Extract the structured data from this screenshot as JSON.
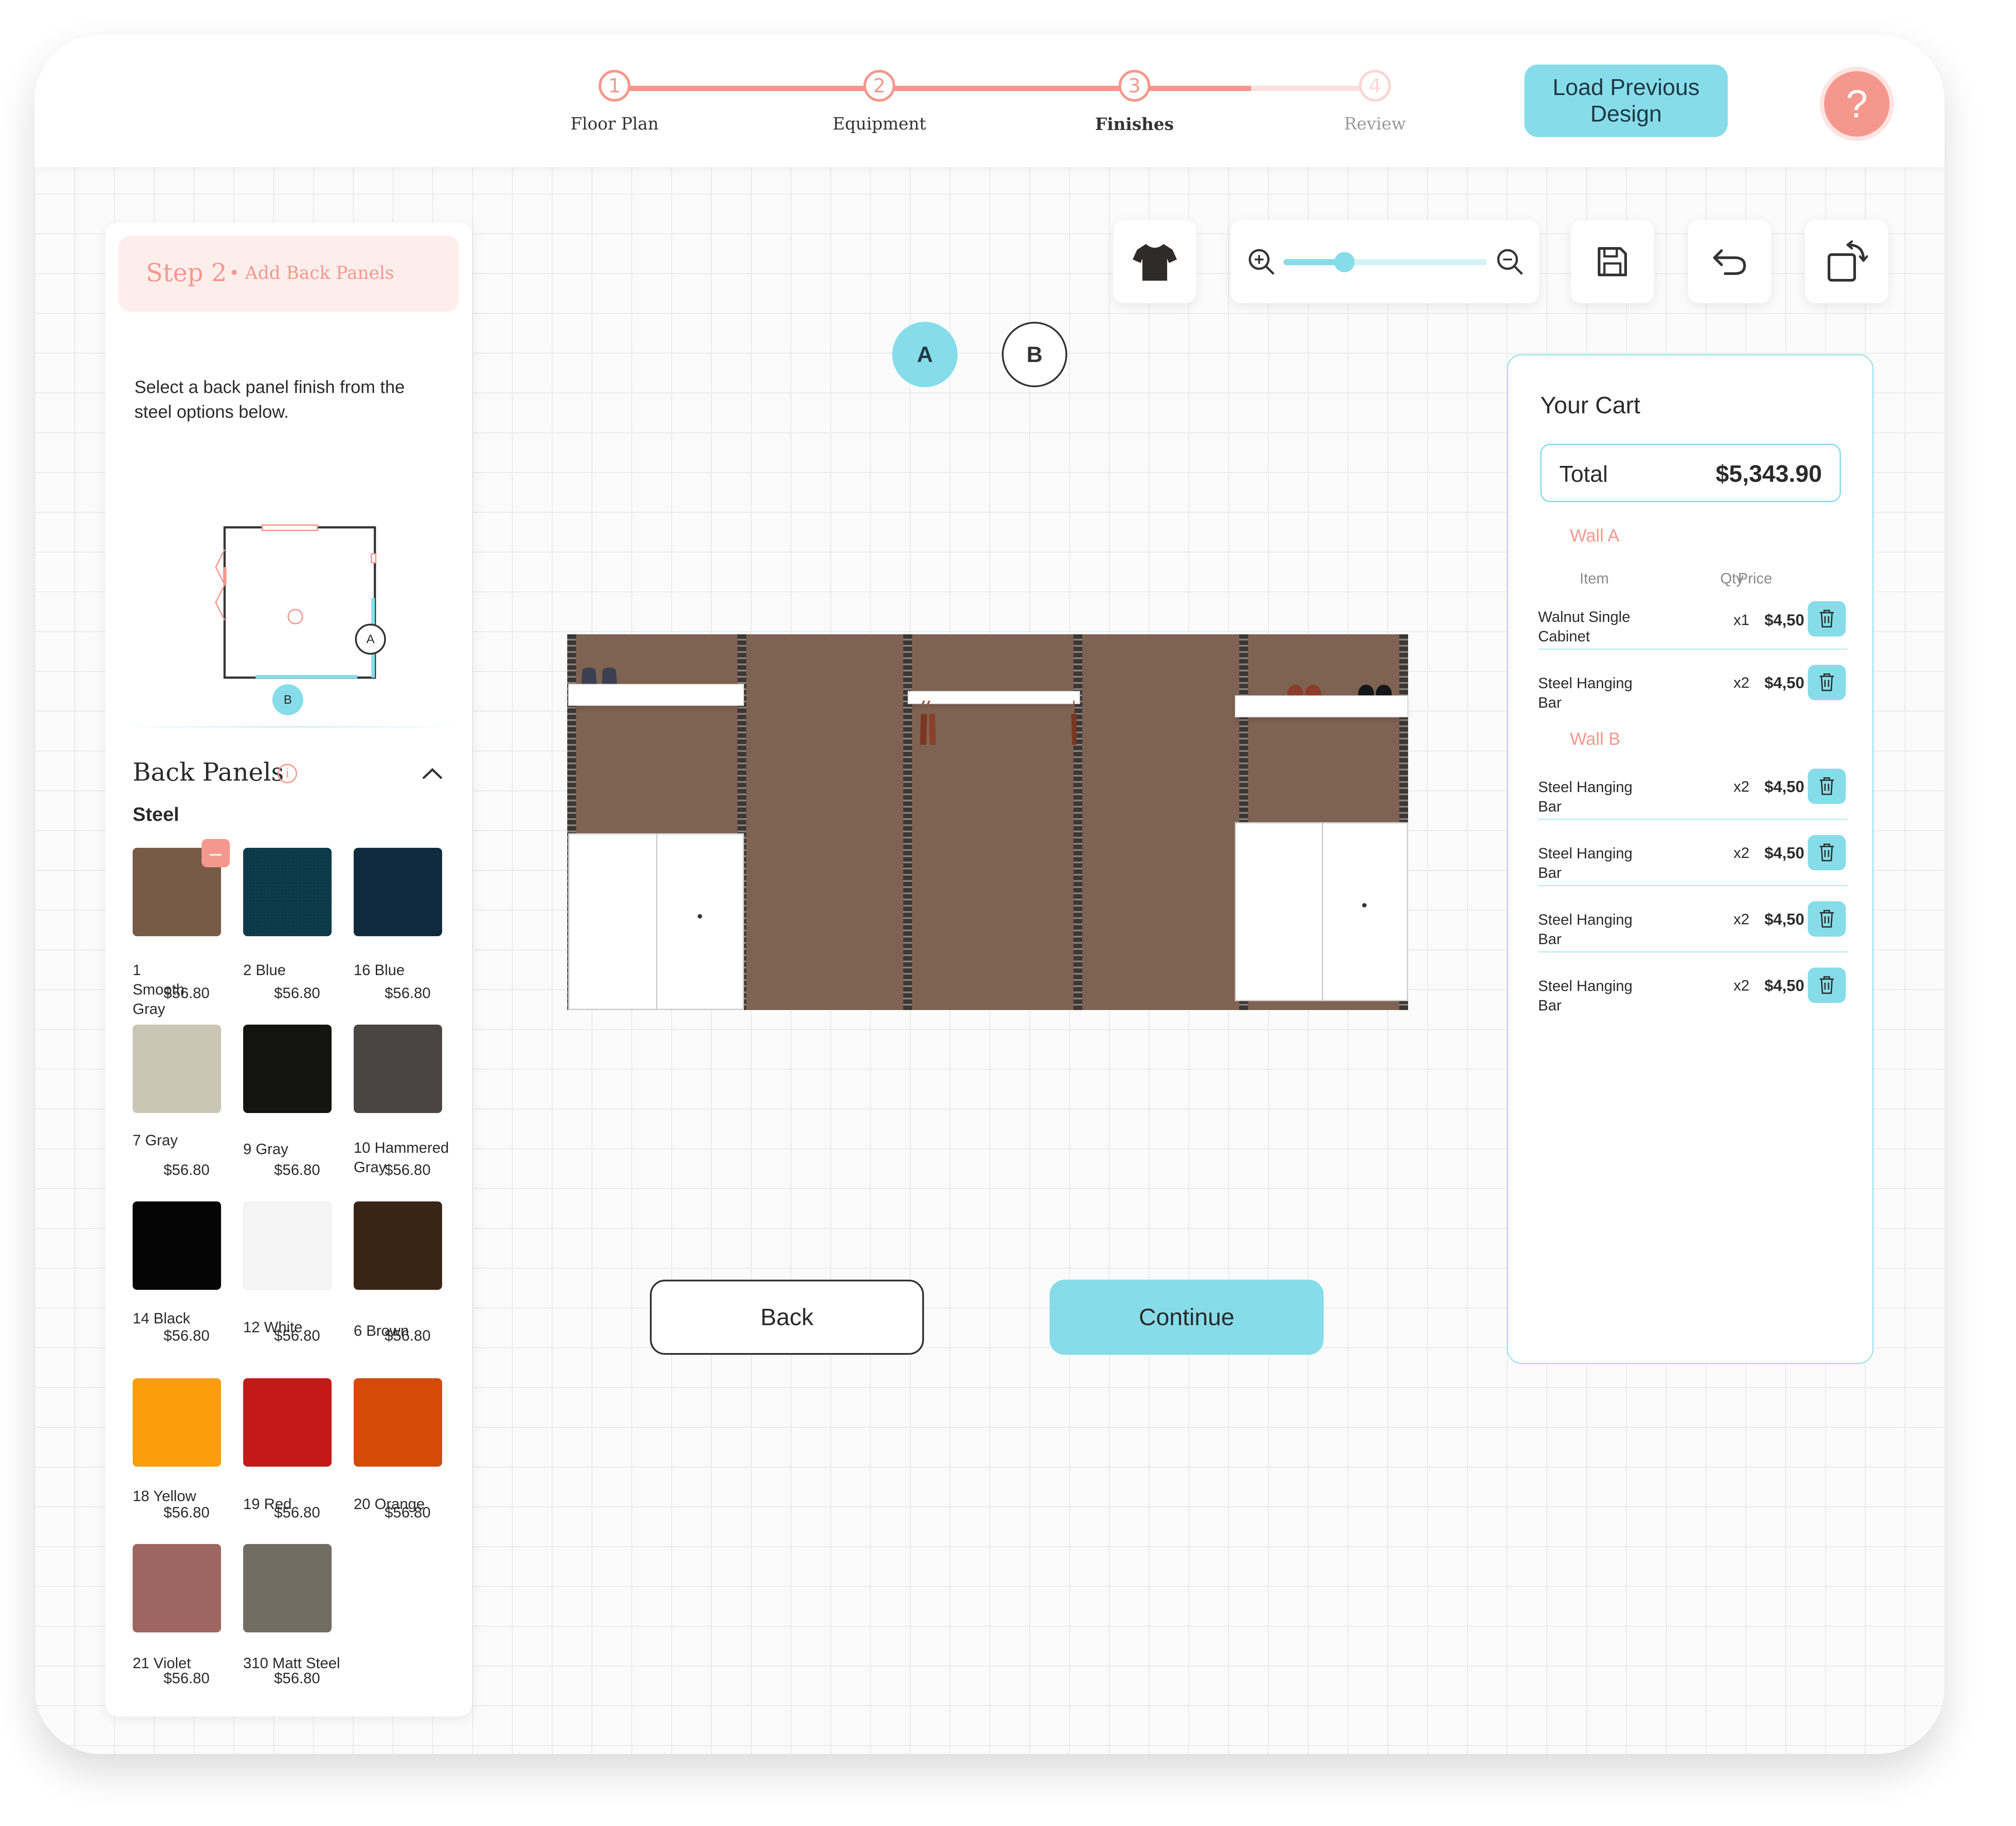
{
  "stepper": {
    "steps": [
      {
        "number": "1",
        "label": "Floor Plan"
      },
      {
        "number": "2",
        "label": "Equipment"
      },
      {
        "number": "3",
        "label": "Finishes"
      },
      {
        "number": "4",
        "label": "Review"
      }
    ],
    "active_step": 3
  },
  "header": {
    "load_button": "Load Previous Design",
    "help_icon": "?"
  },
  "sidebar": {
    "step_title": "Step 2",
    "step_subtitle": "• Add Back Panels",
    "instructions": "Select a back panel finish from the steel options below.",
    "floorplan_markers": {
      "a": "A",
      "b": "B"
    },
    "section_title": "Back Panels",
    "group_title": "Steel",
    "swatches": [
      {
        "name": "1 Smooth Gray",
        "price": "$56.80",
        "color": "#785a47",
        "selected": true
      },
      {
        "name": "2 Blue",
        "price": "$56.80",
        "color": "#0c3a47"
      },
      {
        "name": "16 Blue",
        "price": "$56.80",
        "color": "#0f2b3d"
      },
      {
        "name": "7 Gray",
        "price": "$56.80",
        "color": "#cac6b6"
      },
      {
        "name": "9 Gray",
        "price": "$56.80",
        "color": "#141512"
      },
      {
        "name": "10 Hammered Gray",
        "price": "$56.80",
        "color": "#4a4542"
      },
      {
        "name": "14 Black",
        "price": "$56.80",
        "color": "#050505"
      },
      {
        "name": "12 White",
        "price": "$56.80",
        "color": "#f5f5f5"
      },
      {
        "name": "6 Brown",
        "price": "$56.80",
        "color": "#3a2515"
      },
      {
        "name": "18 Yellow",
        "price": "$56.80",
        "color": "#fb9e0c"
      },
      {
        "name": "19 Red",
        "price": "$56.80",
        "color": "#c51919"
      },
      {
        "name": "20 Orange",
        "price": "$56.80",
        "color": "#d44a06"
      },
      {
        "name": "21 Violet",
        "price": "$56.80",
        "color": "#9e6660"
      },
      {
        "name": "310 Matt Steel",
        "price": "$56.80",
        "color": "#716d62"
      }
    ]
  },
  "walls": {
    "a": "A",
    "b": "B",
    "active": "A"
  },
  "actions": {
    "back": "Back",
    "continue": "Continue"
  },
  "cart": {
    "title": "Your Cart",
    "total_label": "Total",
    "total_value": "$5,343.90",
    "col_item": "Item",
    "col_qty": "Qty",
    "col_price": "Price",
    "wall_a_title": "Wall A",
    "wall_b_title": "Wall B",
    "wall_a_items": [
      {
        "name": "Walnut Single Cabinet",
        "qty": "x1",
        "price": "$4,50"
      },
      {
        "name": "Steel Hanging Bar",
        "qty": "x2",
        "price": "$4,50"
      }
    ],
    "wall_b_items": [
      {
        "name": "Steel Hanging Bar",
        "qty": "x2",
        "price": "$4,50"
      },
      {
        "name": "Steel Hanging Bar",
        "qty": "x2",
        "price": "$4,50"
      },
      {
        "name": "Steel Hanging Bar",
        "qty": "x2",
        "price": "$4,50"
      },
      {
        "name": "Steel Hanging Bar",
        "qty": "x2",
        "price": "$4,50"
      }
    ]
  },
  "colors": {
    "accent": "#86dde9",
    "coral": "#f4988e",
    "panel": "#7e6252"
  },
  "zoom": {
    "level": 0.3
  }
}
